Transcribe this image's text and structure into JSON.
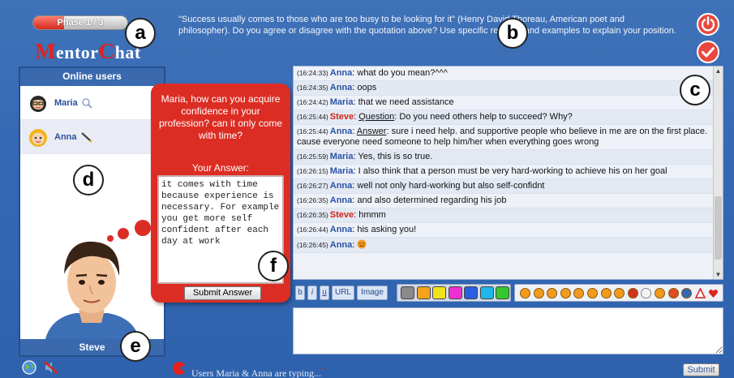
{
  "header": {
    "phase_label": "Phase 1 / 3",
    "phase_progress": 0.33,
    "logo_m": "M",
    "logo_part1": "entor",
    "logo_c": "C",
    "logo_part2": "hat",
    "topic_text": "\"Success usually comes to those who are too busy to be looking for it\" (Henry David Thoreau, American poet and philosopher). Do you agree or disagree with the quotation above? Use specific reasons and examples to explain your position.",
    "power_icon": "power-icon",
    "check_icon": "check-icon"
  },
  "callouts": [
    "a",
    "b",
    "c",
    "d",
    "e",
    "f"
  ],
  "users_panel": {
    "title": "Online users",
    "users": [
      {
        "name": "Maria",
        "status_icon": "magnifier-icon"
      },
      {
        "name": "Anna",
        "status_icon": "pencil-icon"
      }
    ],
    "agent_name": "Steve"
  },
  "question": {
    "text": "Maria, how can you acquire confidence in your profession? can it only come with time?",
    "answer_label": "Your Answer:",
    "answer_value": "it comes with time because experience is necessary. For example you get more self confident after each day at work",
    "submit_label": "Submit Answer"
  },
  "chat": {
    "messages": [
      {
        "time": "(16:24:33)",
        "speaker": "Anna",
        "text": "what do you mean?^^^"
      },
      {
        "time": "(16:24:35)",
        "speaker": "Anna",
        "text": "oops"
      },
      {
        "time": "(16:24:42)",
        "speaker": "Maria",
        "text": "that we need assistance"
      },
      {
        "time": "(16:25:44)",
        "speaker": "Steve",
        "keyword": "Question",
        "text": "Do you need others help to succeed? Why?"
      },
      {
        "time": "(16:25:44)",
        "speaker": "Anna",
        "keyword": "Answer",
        "text": "sure i need help. and supportive people who believe in me are on the first place. cause everyone need someone to help him/her when everything goes wrong"
      },
      {
        "time": "(16:25:59)",
        "speaker": "Maria",
        "text": "Yes, this is so true."
      },
      {
        "time": "(16:26:15)",
        "speaker": "Maria",
        "text": "I also think that a person must be very hard-working to achieve his on her goal"
      },
      {
        "time": "(16:26:27)",
        "speaker": "Anna",
        "text": "well not only hard-working but also self-confidnt"
      },
      {
        "time": "(16:26:35)",
        "speaker": "Anna",
        "text": "and also determined regarding his job"
      },
      {
        "time": "(16:26:35)",
        "speaker": "Steve",
        "text": "hmmm"
      },
      {
        "time": "(16:26:44)",
        "speaker": "Anna",
        "text": "his asking you!"
      },
      {
        "time": "(16:26:45)",
        "speaker": "Anna",
        "text": "",
        "emoji": "smiley-icon"
      }
    ]
  },
  "toolbar": {
    "format_buttons": [
      {
        "label": "b",
        "name": "bold-button"
      },
      {
        "label": "i",
        "name": "italic-button"
      },
      {
        "label": "u",
        "name": "underline-button"
      },
      {
        "label": "URL",
        "name": "url-button"
      },
      {
        "label": "Image",
        "name": "image-button"
      }
    ],
    "colors": [
      "#8a8a8a",
      "#f5a21c",
      "#f1e21c",
      "#ee2fd0",
      "#2a5fe0",
      "#1fb8e8",
      "#35c72f"
    ],
    "emoticons": [
      {
        "name": "smile-emoji",
        "color": "#f29a1c"
      },
      {
        "name": "sad-emoji",
        "color": "#f29a1c"
      },
      {
        "name": "laugh-emoji",
        "color": "#f29a1c"
      },
      {
        "name": "tongue-emoji",
        "color": "#f29a1c"
      },
      {
        "name": "wink-emoji",
        "color": "#f29a1c"
      },
      {
        "name": "cool-emoji",
        "color": "#f29a1c"
      },
      {
        "name": "surprised-emoji",
        "color": "#f29a1c"
      },
      {
        "name": "angry-emoji",
        "color": "#f29a1c"
      },
      {
        "name": "devil-emoji",
        "color": "#d2331b"
      },
      {
        "name": "lightbulb-emoji",
        "color": "#f4f4f4"
      },
      {
        "name": "info-emoji",
        "color": "#f29a1c"
      },
      {
        "name": "exclaim-emoji",
        "color": "#e04b1f"
      },
      {
        "name": "question-emoji",
        "color": "#3468b3"
      },
      {
        "name": "warning-emoji",
        "color": "#d9261c"
      },
      {
        "name": "heart-emoji",
        "color": "#d9261c"
      }
    ]
  },
  "submit_label": "Submit",
  "typing_status": "Users Maria & Anna are typing...",
  "typing_star": "*",
  "bottom_icons": [
    "globe-icon",
    "no-sound-icon"
  ],
  "colors": {
    "background": "#3468b3",
    "accent_red": "#dc2d24",
    "user_name": "#2b53a6",
    "agent_name": "#d42318"
  }
}
